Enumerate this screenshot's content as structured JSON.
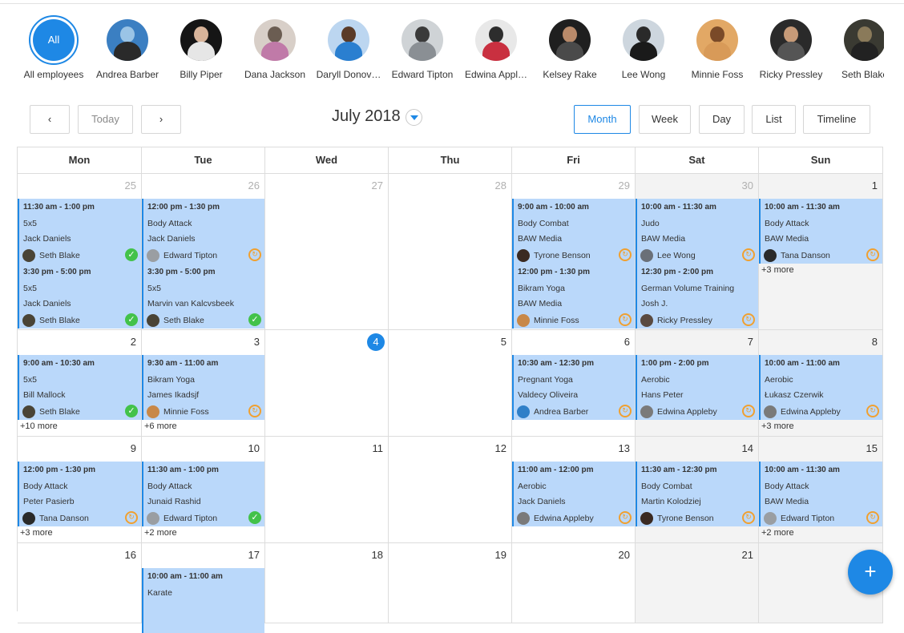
{
  "employees": {
    "all_label": "All",
    "items": [
      {
        "name": "All employees"
      },
      {
        "name": "Andrea Barber",
        "colors": [
          "#3b7fc2",
          "#9ac4e6",
          "#2a2a2a"
        ]
      },
      {
        "name": "Billy Piper",
        "colors": [
          "#151515",
          "#d8b49a",
          "#e6e6e6"
        ]
      },
      {
        "name": "Dana Jackson",
        "colors": [
          "#d8cfc8",
          "#6b5d52",
          "#c07aa8"
        ]
      },
      {
        "name": "Daryll Donov…",
        "colors": [
          "#bcd6f0",
          "#5a3b28",
          "#2a7fd0"
        ]
      },
      {
        "name": "Edward Tipton",
        "colors": [
          "#cfd3d6",
          "#3a3a3a",
          "#8a8f94"
        ]
      },
      {
        "name": "Edwina Appl…",
        "colors": [
          "#e8e8e8",
          "#2d2d2d",
          "#c93040"
        ]
      },
      {
        "name": "Kelsey Rake",
        "colors": [
          "#1f1f1f",
          "#b98a6a",
          "#4a4a4a"
        ]
      },
      {
        "name": "Lee Wong",
        "colors": [
          "#cdd6de",
          "#2a2a2a",
          "#1a1a1a"
        ]
      },
      {
        "name": "Minnie Foss",
        "colors": [
          "#e2a865",
          "#7a4a28",
          "#d89a58"
        ]
      },
      {
        "name": "Ricky Pressley",
        "colors": [
          "#2a2a2a",
          "#c69a78",
          "#555555"
        ]
      },
      {
        "name": "Seth Blake",
        "colors": [
          "#3a3a32",
          "#8a7a5a",
          "#222222"
        ]
      }
    ]
  },
  "toolbar": {
    "prev": "‹",
    "today": "Today",
    "next": "›",
    "title": "July 2018",
    "views": [
      "Month",
      "Week",
      "Day",
      "List",
      "Timeline"
    ],
    "active_view": "Month"
  },
  "calendar": {
    "weekdays": [
      "Mon",
      "Tue",
      "Wed",
      "Thu",
      "Fri",
      "Sat",
      "Sun"
    ],
    "weeks": [
      {
        "days": [
          {
            "num": "25",
            "other": true,
            "events": [
              {
                "time": "11:30 am - 1:00 pm",
                "a": "5x5",
                "b": "Jack Daniels",
                "person": "Seth Blake",
                "status": "done"
              },
              {
                "time": "3:30 pm - 5:00 pm",
                "a": "5x5",
                "b": "Jack Daniels",
                "person": "Seth Blake",
                "status": "done"
              }
            ]
          },
          {
            "num": "26",
            "other": true,
            "events": [
              {
                "time": "12:00 pm - 1:30 pm",
                "a": "Body Attack",
                "b": "Jack Daniels",
                "person": "Edward Tipton",
                "status": "pending"
              },
              {
                "time": "3:30 pm - 5:00 pm",
                "a": "5x5",
                "b": "Marvin van Kalcvsbeek",
                "person": "Seth Blake",
                "status": "done"
              }
            ]
          },
          {
            "num": "27",
            "other": true,
            "events": []
          },
          {
            "num": "28",
            "other": true,
            "events": []
          },
          {
            "num": "29",
            "other": true,
            "events": [
              {
                "time": "9:00 am - 10:00 am",
                "a": "Body Combat",
                "b": "BAW Media",
                "person": "Tyrone Benson",
                "status": "pending"
              },
              {
                "time": "12:00 pm - 1:30 pm",
                "a": "Bikram Yoga",
                "b": "BAW Media",
                "person": "Minnie Foss",
                "status": "pending"
              }
            ]
          },
          {
            "num": "30",
            "other": true,
            "weekend": true,
            "events": [
              {
                "time": "10:00 am - 11:30 am",
                "a": "Judo",
                "b": "BAW Media",
                "person": "Lee Wong",
                "status": "pending"
              },
              {
                "time": "12:30 pm - 2:00 pm",
                "a": "German Volume Training",
                "b": "Josh J.",
                "person": "Ricky Pressley",
                "status": "pending"
              }
            ]
          },
          {
            "num": "1",
            "weekend": true,
            "events": [
              {
                "time": "10:00 am - 11:30 am",
                "a": "Body Attack",
                "b": "BAW Media",
                "person": "Tana Danson",
                "status": "pending"
              }
            ],
            "more": "+3 more"
          }
        ]
      },
      {
        "days": [
          {
            "num": "2",
            "events": [
              {
                "time": "9:00 am - 10:30 am",
                "a": "5x5",
                "b": "Bill Mallock",
                "person": "Seth Blake",
                "status": "done"
              }
            ],
            "more": "+10 more"
          },
          {
            "num": "3",
            "events": [
              {
                "time": "9:30 am - 11:00 am",
                "a": "Bikram Yoga",
                "b": "James Ikadsjf",
                "person": "Minnie Foss",
                "status": "pending"
              }
            ],
            "more": "+6 more"
          },
          {
            "num": "4",
            "today": true,
            "events": []
          },
          {
            "num": "5",
            "events": []
          },
          {
            "num": "6",
            "events": [
              {
                "time": "10:30 am - 12:30 pm",
                "a": "Pregnant Yoga",
                "b": "Valdecy Oliveira",
                "person": "Andrea Barber",
                "status": "pending"
              }
            ]
          },
          {
            "num": "7",
            "weekend": true,
            "events": [
              {
                "time": "1:00 pm - 2:00 pm",
                "a": "Aerobic",
                "b": "Hans Peter",
                "person": "Edwina Appleby",
                "status": "pending"
              }
            ]
          },
          {
            "num": "8",
            "weekend": true,
            "events": [
              {
                "time": "10:00 am - 11:00 am",
                "a": "Aerobic",
                "b": "Łukasz Czerwik",
                "person": "Edwina Appleby",
                "status": "pending"
              }
            ],
            "more": "+3 more"
          }
        ]
      },
      {
        "days": [
          {
            "num": "9",
            "events": [
              {
                "time": "12:00 pm - 1:30 pm",
                "a": "Body Attack",
                "b": "Peter Pasierb",
                "person": "Tana Danson",
                "status": "pending"
              }
            ],
            "more": "+3 more"
          },
          {
            "num": "10",
            "events": [
              {
                "time": "11:30 am - 1:00 pm",
                "a": "Body Attack",
                "b": "Junaid Rashid",
                "person": "Edward Tipton",
                "status": "done"
              }
            ],
            "more": "+2 more"
          },
          {
            "num": "11",
            "events": []
          },
          {
            "num": "12",
            "events": []
          },
          {
            "num": "13",
            "events": [
              {
                "time": "11:00 am - 12:00 pm",
                "a": "Aerobic",
                "b": "Jack Daniels",
                "person": "Edwina Appleby",
                "status": "pending"
              }
            ]
          },
          {
            "num": "14",
            "weekend": true,
            "events": [
              {
                "time": "11:30 am - 12:30 pm",
                "a": "Body Combat",
                "b": "Martin Kolodziej",
                "person": "Tyrone Benson",
                "status": "pending"
              }
            ]
          },
          {
            "num": "15",
            "weekend": true,
            "events": [
              {
                "time": "10:00 am - 11:30 am",
                "a": "Body Attack",
                "b": "BAW Media",
                "person": "Edward Tipton",
                "status": "pending"
              }
            ],
            "more": "+2 more"
          }
        ]
      },
      {
        "days": [
          {
            "num": "16",
            "events": []
          },
          {
            "num": "17",
            "events": [
              {
                "time": "10:00 am - 11:00 am",
                "a": "Karate",
                "b": "",
                "person": "",
                "status": ""
              }
            ]
          },
          {
            "num": "18",
            "events": []
          },
          {
            "num": "19",
            "events": []
          },
          {
            "num": "20",
            "events": []
          },
          {
            "num": "21",
            "weekend": true,
            "events": []
          },
          {
            "num": "",
            "weekend": true,
            "events": []
          }
        ]
      }
    ]
  },
  "person_colors": {
    "Seth Blake": "#4a4436",
    "Edward Tipton": "#9a9ea2",
    "Tyrone Benson": "#3a2a22",
    "Minnie Foss": "#c88848",
    "Lee Wong": "#6a7078",
    "Ricky Pressley": "#5a4a40",
    "Tana Danson": "#2a2a2a",
    "Andrea Barber": "#2f7fc8",
    "Edwina Appleby": "#7a7a7a"
  },
  "status_icons": {
    "done": "✓",
    "pending": "↻"
  },
  "fab": {
    "label": "+",
    "icon": "add-icon"
  },
  "accent": "#1e88e5"
}
